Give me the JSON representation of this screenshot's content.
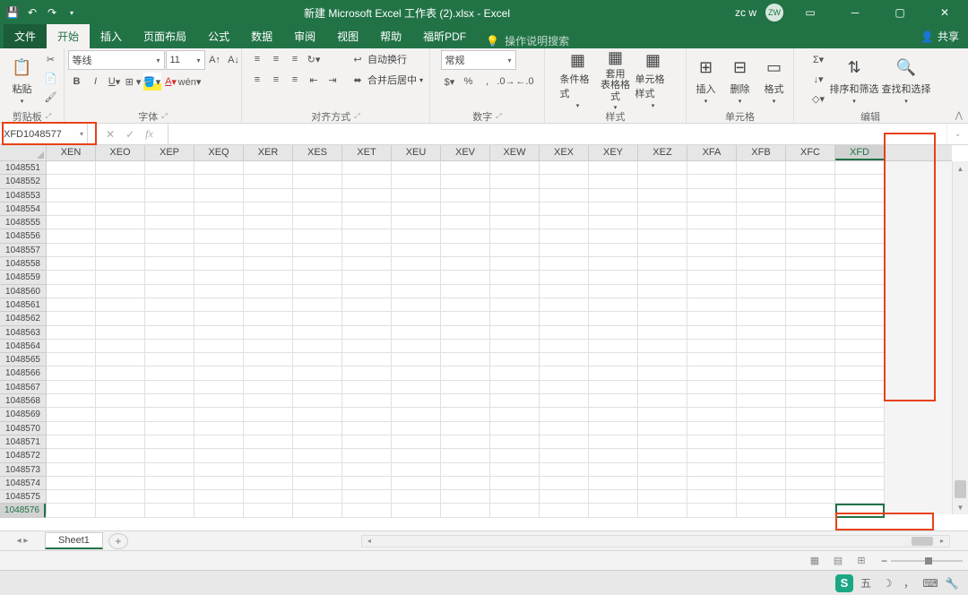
{
  "title": "新建 Microsoft Excel 工作表 (2).xlsx - Excel",
  "user": {
    "name": "zc w",
    "initials": "ZW"
  },
  "tabs": {
    "file": "文件",
    "items": [
      "开始",
      "插入",
      "页面布局",
      "公式",
      "数据",
      "审阅",
      "视图",
      "帮助",
      "福昕PDF"
    ],
    "active": 0,
    "tell": "操作说明搜索",
    "share": "共享"
  },
  "groups": {
    "clipboard": {
      "label": "剪贴板",
      "paste": "粘贴"
    },
    "font": {
      "label": "字体",
      "name": "等线",
      "size": "11"
    },
    "align": {
      "label": "对齐方式",
      "wrap": "自动换行",
      "merge": "合并后居中"
    },
    "number": {
      "label": "数字",
      "format": "常规"
    },
    "styles": {
      "label": "样式",
      "cond": "条件格式",
      "table": "套用\n表格格式",
      "cell": "单元格样式"
    },
    "cells": {
      "label": "单元格",
      "insert": "插入",
      "delete": "删除",
      "format": "格式"
    },
    "editing": {
      "label": "编辑",
      "sort": "排序和筛选",
      "find": "查找和选择"
    }
  },
  "namebox": "XFD1048577",
  "columns": [
    "XEN",
    "XEO",
    "XEP",
    "XEQ",
    "XER",
    "XES",
    "XET",
    "XEU",
    "XEV",
    "XEW",
    "XEX",
    "XEY",
    "XEZ",
    "XFA",
    "XFB",
    "XFC",
    "XFD"
  ],
  "rows": [
    1048551,
    1048552,
    1048553,
    1048554,
    1048555,
    1048556,
    1048557,
    1048558,
    1048559,
    1048560,
    1048561,
    1048562,
    1048563,
    1048564,
    1048565,
    1048566,
    1048567,
    1048568,
    1048569,
    1048570,
    1048571,
    1048572,
    1048573,
    1048574,
    1048575,
    1048576
  ],
  "active_cell": {
    "col": "XFD",
    "row": 1048576
  },
  "sheet": "Sheet1",
  "taskbar_ime": "五"
}
